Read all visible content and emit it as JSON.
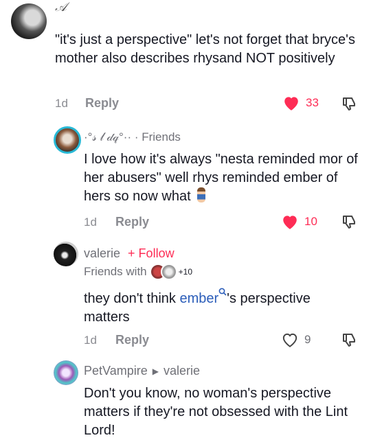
{
  "comments": [
    {
      "username": "𝒜",
      "text": "\"it's just a perspective\" let's not forget that bryce's mother also describes rhysand NOT positively",
      "time": "1d",
      "reply_label": "Reply",
      "likes": "33",
      "liked": true
    },
    {
      "username": "·°𝓈 𝓁 𝒹𝓆°·· · Friends",
      "text": "I love how it's always \"nesta reminded mor of her abusers\" well rhys reminded ember of hers so now what",
      "time": "1d",
      "reply_label": "Reply",
      "likes": "10",
      "liked": true
    },
    {
      "username": "valerie",
      "follow_label": "+ Follow",
      "friends_label": "Friends with",
      "friends_more": "+10",
      "text_before": "they don't think ",
      "mention": "ember",
      "text_after": "'s perspective matters",
      "time": "1d",
      "reply_label": "Reply",
      "likes": "9",
      "liked": false
    },
    {
      "username": "PetVampire",
      "reply_to": "valerie",
      "text": "Don't you know, no woman's perspective matters if they're not obsessed with the Lint Lord!"
    }
  ],
  "colors": {
    "like_red": "#fe2c55",
    "mention_blue": "#2b5db9",
    "muted": "#8a8b91"
  }
}
